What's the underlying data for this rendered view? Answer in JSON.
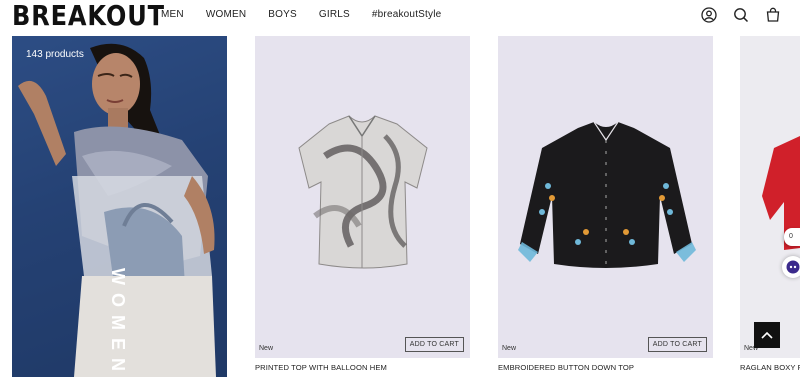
{
  "header": {
    "logo": "BREAKOUT",
    "nav": [
      "MEN",
      "WOMEN",
      "BOYS",
      "GIRLS",
      "#breakoutStyle"
    ]
  },
  "hero": {
    "count": "143 products",
    "vertical_text": "WOMEN"
  },
  "products": [
    {
      "badge": "New",
      "cta": "ADD TO CART",
      "title": "PRINTED TOP WITH BALLOON HEM"
    },
    {
      "badge": "New",
      "cta": "ADD TO CART",
      "title": "EMBROIDERED BUTTON DOWN TOP"
    },
    {
      "badge": "New",
      "title": "RAGLAN BOXY F"
    }
  ],
  "widgets": {
    "side_label": "0"
  },
  "colors": {
    "hero_bg": "#2e4f86",
    "card_bg": "#e6e3ee",
    "accent_red": "#d0202a"
  }
}
